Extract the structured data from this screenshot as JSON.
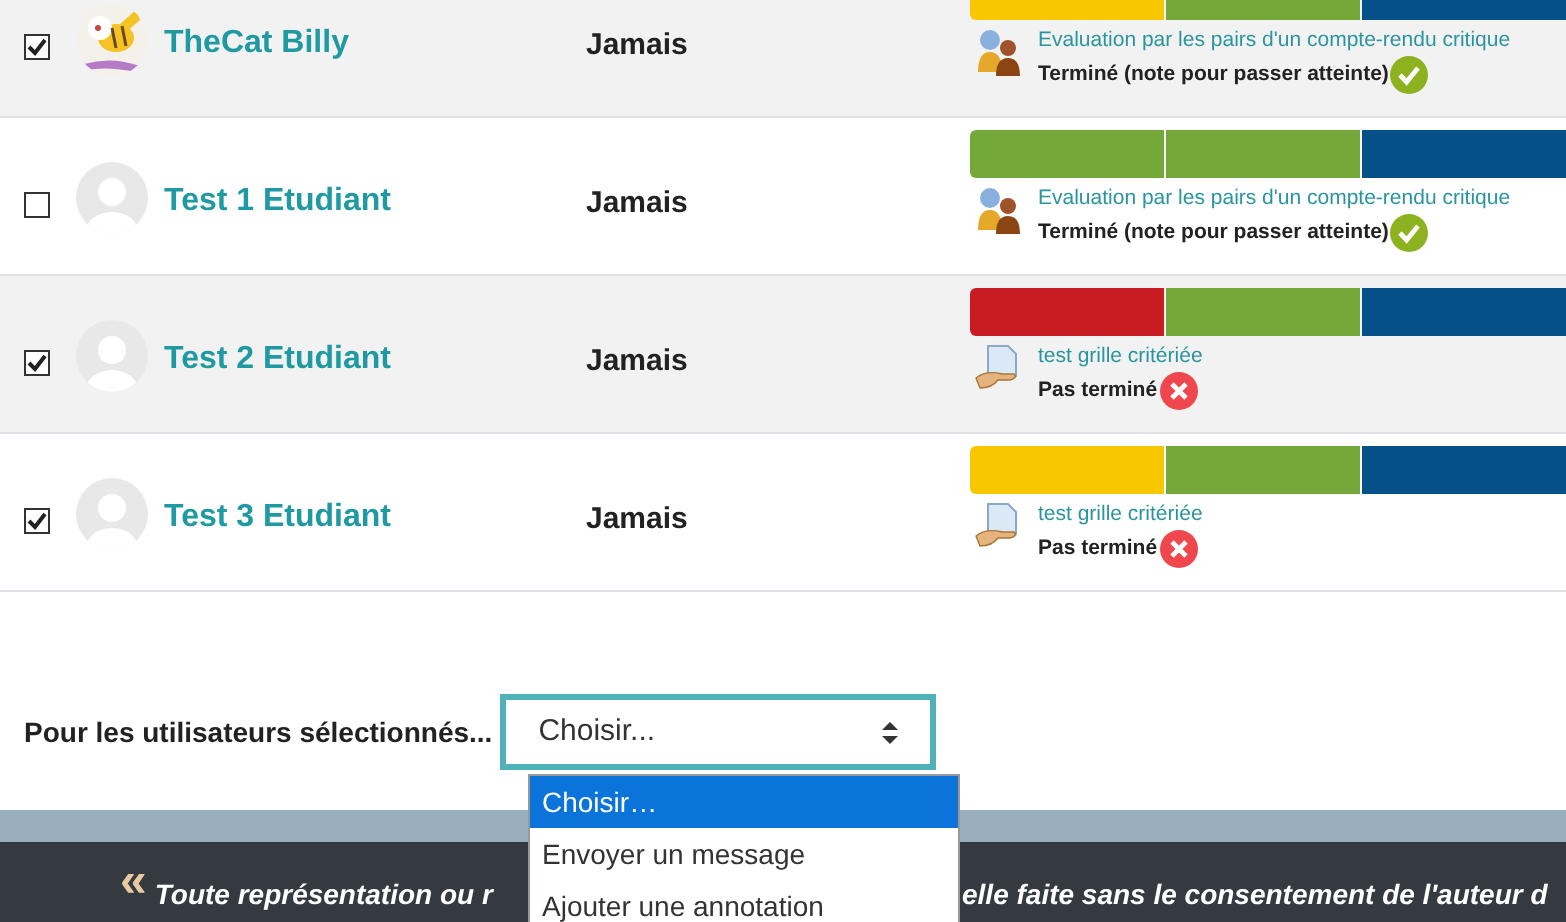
{
  "rows": [
    {
      "selected": true,
      "avatar": {
        "kind": "picture"
      },
      "name": "TheCat Billy",
      "last_access": "Jamais",
      "progress": [
        {
          "color": "#f9c700"
        },
        {
          "color": "#74a838"
        },
        {
          "color": "#055088"
        }
      ],
      "activity": {
        "kind": "workshop",
        "title": "Evaluation par les pairs d'un compte-rendu critique",
        "status": "Terminé (note pour passer atteinte)",
        "done": true
      }
    },
    {
      "selected": false,
      "avatar": {
        "kind": "default"
      },
      "name": "Test 1 Etudiant",
      "last_access": "Jamais",
      "progress": [
        {
          "color": "#74a838"
        },
        {
          "color": "#74a838"
        },
        {
          "color": "#055088"
        }
      ],
      "activity": {
        "kind": "workshop",
        "title": "Evaluation par les pairs d'un compte-rendu critique",
        "status": "Terminé (note pour passer atteinte)",
        "done": true
      }
    },
    {
      "selected": true,
      "avatar": {
        "kind": "default"
      },
      "name": "Test 2 Etudiant",
      "last_access": "Jamais",
      "progress": [
        {
          "color": "#c91c22"
        },
        {
          "color": "#74a838"
        },
        {
          "color": "#055088"
        }
      ],
      "activity": {
        "kind": "assignment",
        "title": "test grille critériée",
        "status": "Pas terminé",
        "done": false
      }
    },
    {
      "selected": true,
      "avatar": {
        "kind": "default"
      },
      "name": "Test 3 Etudiant",
      "last_access": "Jamais",
      "progress": [
        {
          "color": "#f9c700"
        },
        {
          "color": "#74a838"
        },
        {
          "color": "#055088"
        }
      ],
      "activity": {
        "kind": "assignment",
        "title": "test grille critériée",
        "status": "Pas terminé",
        "done": false
      }
    }
  ],
  "bulk_action": {
    "label": "Pour les utilisateurs sélectionnés...",
    "value": "Choisir...",
    "options": [
      {
        "label": "Choisir…",
        "selected": true
      },
      {
        "label": "Envoyer un message",
        "selected": false
      },
      {
        "label": "Ajouter une annotation",
        "selected": false
      }
    ]
  },
  "footer": {
    "quote_mark": "«",
    "text_start": "Toute représentation ou r",
    "text_end": "elle faite sans le consentement de l'auteur d"
  }
}
